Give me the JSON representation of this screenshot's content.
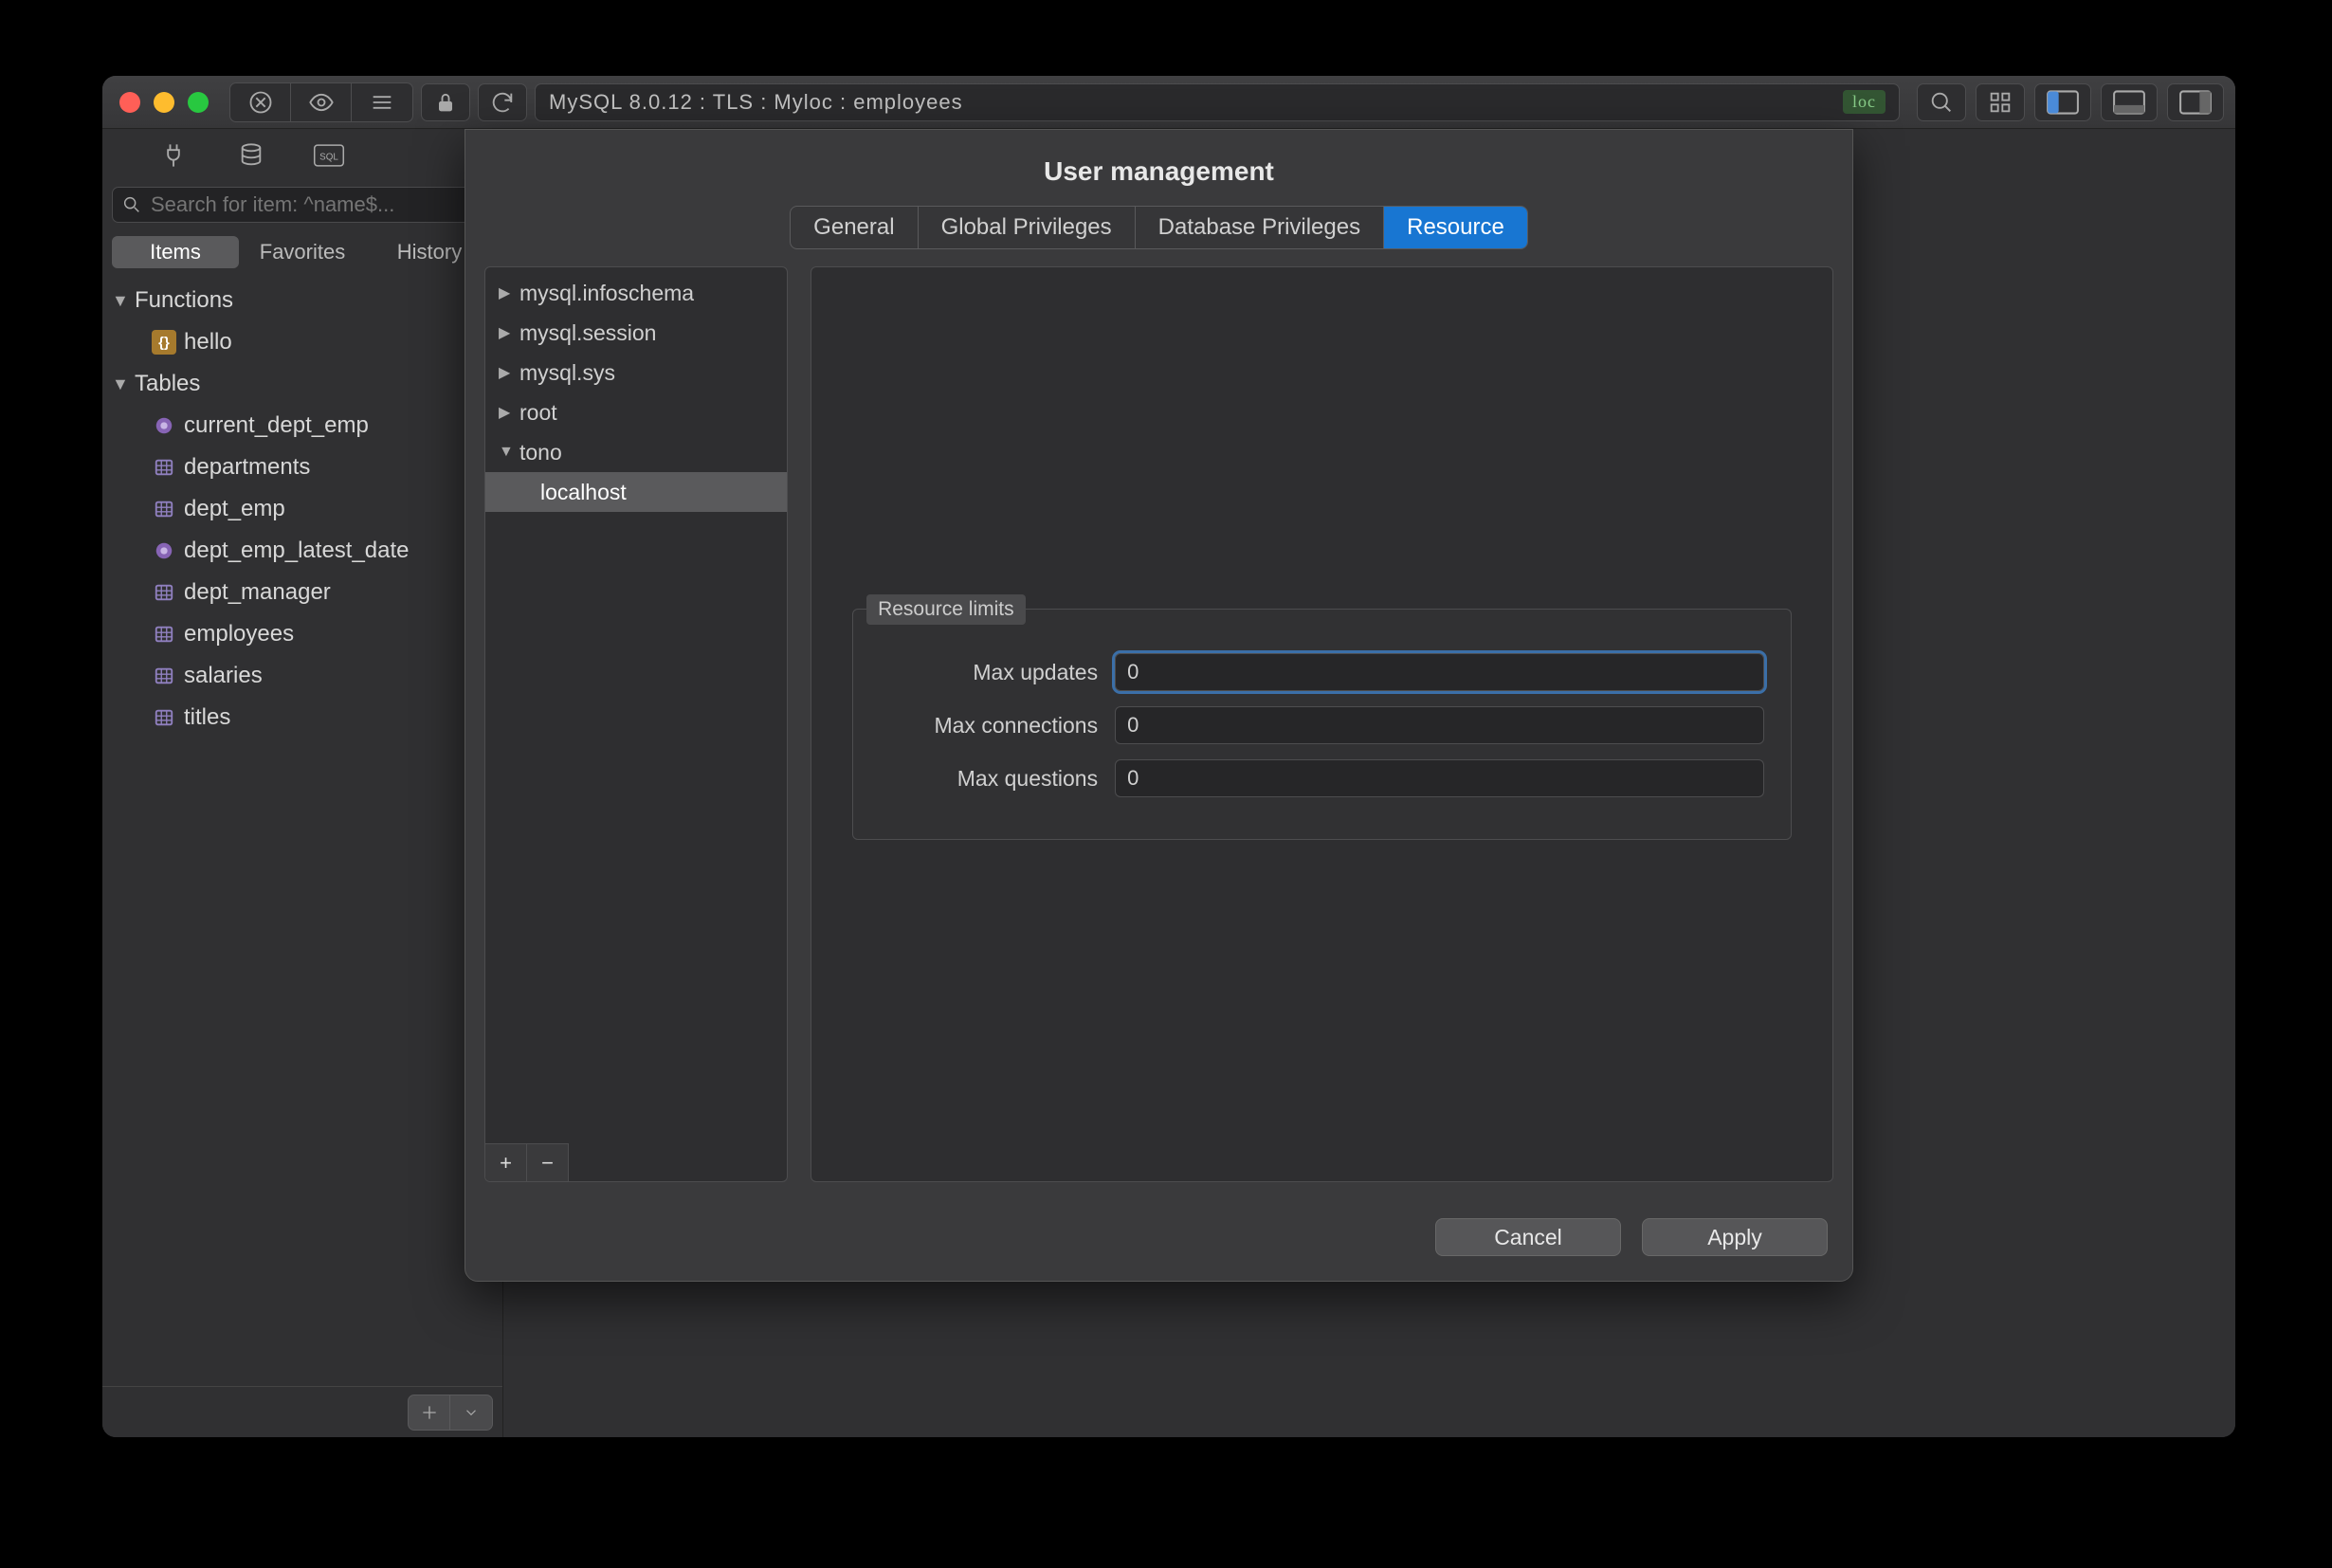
{
  "titlebar": {
    "connection_text": "MySQL 8.0.12 : TLS : Myloc : employees",
    "badge": "loc"
  },
  "sidebar": {
    "search_placeholder": "Search for item: ^name$...",
    "tabs": [
      "Items",
      "Favorites",
      "History"
    ],
    "active_tab": 0,
    "sections": [
      {
        "name": "Functions",
        "expanded": true,
        "children": [
          {
            "label": "hello",
            "kind": "fn"
          }
        ]
      },
      {
        "name": "Tables",
        "expanded": true,
        "children": [
          {
            "label": "current_dept_emp",
            "kind": "view"
          },
          {
            "label": "departments",
            "kind": "table"
          },
          {
            "label": "dept_emp",
            "kind": "table"
          },
          {
            "label": "dept_emp_latest_date",
            "kind": "view"
          },
          {
            "label": "dept_manager",
            "kind": "table"
          },
          {
            "label": "employees",
            "kind": "table"
          },
          {
            "label": "salaries",
            "kind": "table"
          },
          {
            "label": "titles",
            "kind": "table"
          }
        ]
      }
    ]
  },
  "modal": {
    "title": "User management",
    "tabs": [
      "General",
      "Global Privileges",
      "Database Privileges",
      "Resource"
    ],
    "active_tab": 3,
    "users": [
      {
        "name": "mysql.infoschema",
        "expanded": false
      },
      {
        "name": "mysql.session",
        "expanded": false
      },
      {
        "name": "mysql.sys",
        "expanded": false
      },
      {
        "name": "root",
        "expanded": false
      },
      {
        "name": "tono",
        "expanded": true,
        "children": [
          {
            "name": "localhost",
            "selected": true
          }
        ]
      }
    ],
    "resource": {
      "legend": "Resource limits",
      "fields": [
        {
          "label": "Max updates",
          "value": "0",
          "focused": true
        },
        {
          "label": "Max connections",
          "value": "0",
          "focused": false
        },
        {
          "label": "Max questions",
          "value": "0",
          "focused": false
        }
      ]
    },
    "buttons": {
      "cancel": "Cancel",
      "apply": "Apply"
    }
  }
}
